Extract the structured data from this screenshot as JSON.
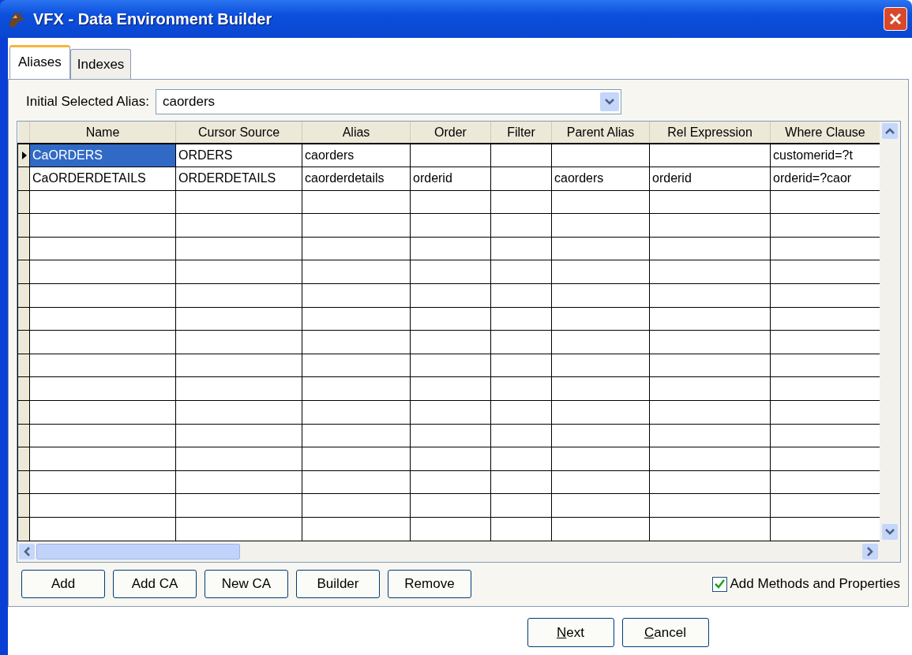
{
  "window": {
    "title": "VFX - Data Environment Builder"
  },
  "tabs": [
    {
      "label": "Aliases",
      "selected": true
    },
    {
      "label": "Indexes",
      "selected": false
    }
  ],
  "alias_field": {
    "label": "Initial Selected Alias:",
    "value": "caorders"
  },
  "grid": {
    "columns": [
      "Name",
      "Cursor Source",
      "Alias",
      "Order",
      "Filter",
      "Parent Alias",
      "Rel Expression",
      "Where Clause"
    ],
    "rows": [
      {
        "selected": true,
        "cells": [
          "CaORDERS",
          "ORDERS",
          "caorders",
          "",
          "",
          "",
          "",
          "customerid=?t"
        ]
      },
      {
        "selected": false,
        "cells": [
          "CaORDERDETAILS",
          "ORDERDETAILS",
          "caorderdetails",
          "orderid",
          "",
          "caorders",
          "orderid",
          "orderid=?caor"
        ]
      }
    ]
  },
  "panel_buttons": [
    "Add",
    "Add CA",
    "New CA",
    "Builder",
    "Remove"
  ],
  "add_methods": {
    "label": "Add Methods and Properties",
    "checked": true
  },
  "footer_buttons": [
    {
      "label": "Next",
      "mnemonic": true
    },
    {
      "label": "Cancel",
      "mnemonic": true
    }
  ]
}
